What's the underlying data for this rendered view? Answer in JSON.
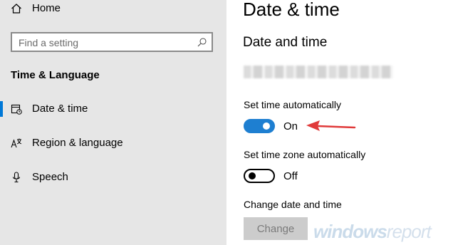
{
  "sidebar": {
    "home_label": "Home",
    "search_placeholder": "Find a setting",
    "section_title": "Time & Language",
    "items": [
      {
        "label": "Date & time",
        "icon": "calendar-clock-icon",
        "selected": true
      },
      {
        "label": "Region & language",
        "icon": "language-icon",
        "selected": false
      },
      {
        "label": "Speech",
        "icon": "microphone-icon",
        "selected": false
      }
    ]
  },
  "main": {
    "title": "Date & time",
    "subtitle": "Date and time",
    "set_time_auto": {
      "label": "Set time automatically",
      "state": "On",
      "on": true
    },
    "set_timezone_auto": {
      "label": "Set time zone automatically",
      "state": "Off",
      "on": false
    },
    "change_section_label": "Change date and time",
    "change_button": "Change"
  },
  "watermark": {
    "bold": "windows",
    "light": "report"
  },
  "colors": {
    "accent": "#0078d7",
    "toggle_on": "#1e7fd1",
    "sidebar_bg": "#e6e6e6",
    "arrow": "#e03a3a"
  }
}
